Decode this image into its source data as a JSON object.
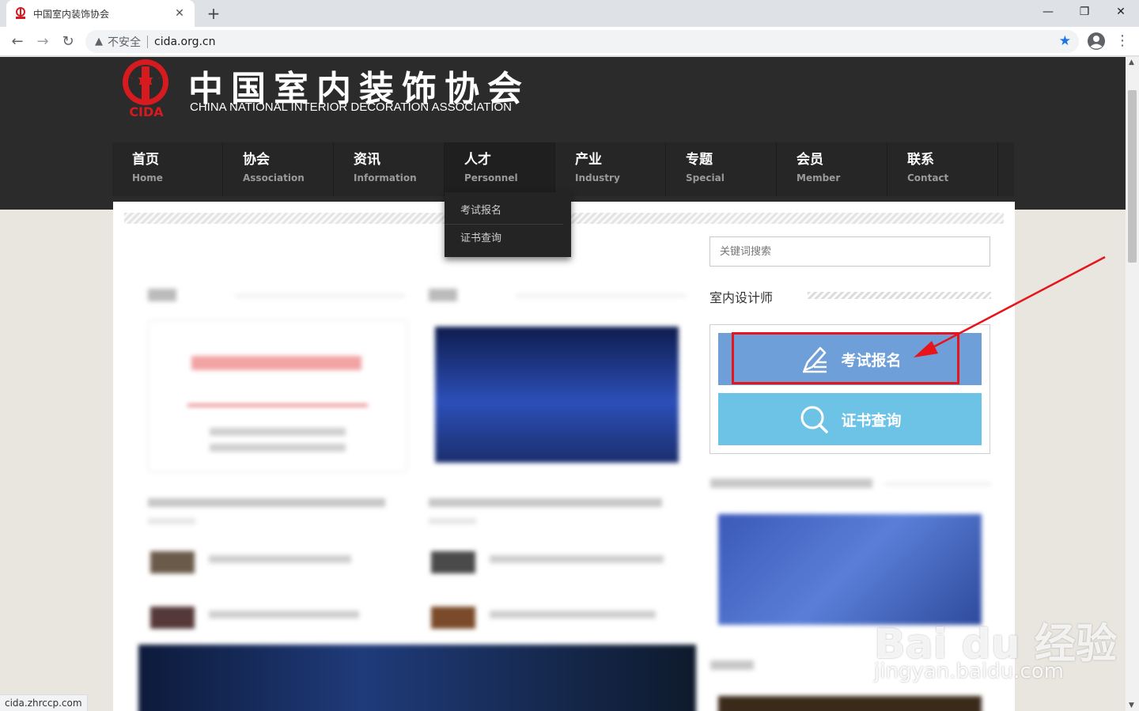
{
  "browser": {
    "tab_title": "中国室内装饰协会",
    "insecure_label": "不安全",
    "url": "cida.org.cn",
    "status_url": "cida.zhrccp.com"
  },
  "site": {
    "title": "中国室内装饰协会",
    "subtitle": "CHINA NATIONAL INTERIOR DECORATION ASSOCIATION",
    "logo_text": "CIDA",
    "brand_color": "#d71920"
  },
  "nav": {
    "items": [
      {
        "cn": "首页",
        "en": "Home"
      },
      {
        "cn": "协会",
        "en": "Association"
      },
      {
        "cn": "资讯",
        "en": "Information"
      },
      {
        "cn": "人才",
        "en": "Personnel"
      },
      {
        "cn": "产业",
        "en": "Industry"
      },
      {
        "cn": "专题",
        "en": "Special"
      },
      {
        "cn": "会员",
        "en": "Member"
      },
      {
        "cn": "联系",
        "en": "Contact"
      }
    ],
    "dropdown": [
      "考试报名",
      "证书查询"
    ]
  },
  "sidebar": {
    "search_placeholder": "关键词搜索",
    "section_title": "室内设计师",
    "exam_button": "考试报名",
    "cert_button": "证书查询",
    "exam_color": "#6f9fd8",
    "cert_color": "#6cc3e6"
  },
  "annotation": {
    "color": "#e8141b"
  },
  "watermark": {
    "brand": "Bai du 经验",
    "url": "jingyan.baidu.com"
  }
}
